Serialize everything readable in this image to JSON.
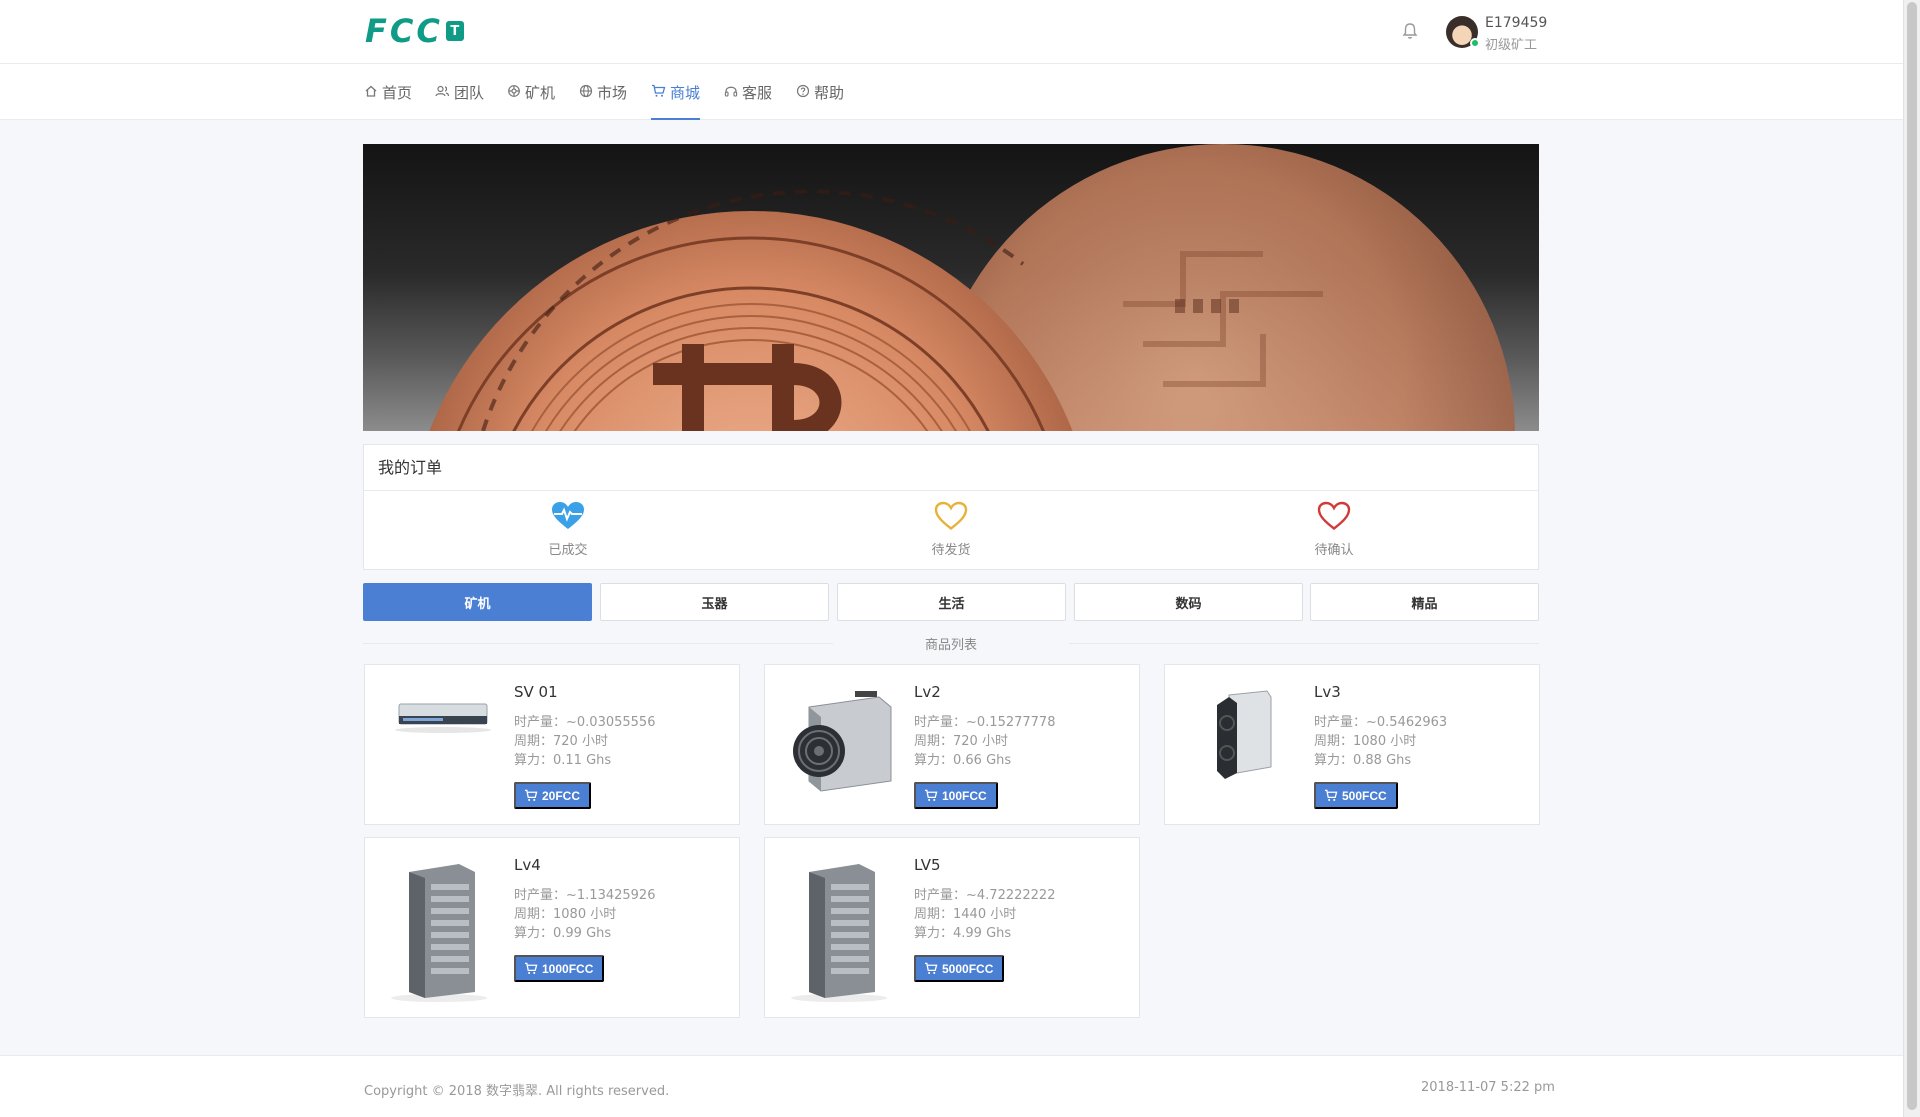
{
  "header": {
    "logo_text": "FCC",
    "logo_badge": "T",
    "user_id": "E179459",
    "user_level": "初级矿工"
  },
  "nav": {
    "items": [
      {
        "label": "首页",
        "icon": "home-icon"
      },
      {
        "label": "团队",
        "icon": "team-icon"
      },
      {
        "label": "矿机",
        "icon": "miner-icon"
      },
      {
        "label": "市场",
        "icon": "globe-icon"
      },
      {
        "label": "商城",
        "icon": "cart-icon",
        "active": true
      },
      {
        "label": "客服",
        "icon": "headset-icon"
      },
      {
        "label": "帮助",
        "icon": "help-icon"
      }
    ]
  },
  "orders": {
    "title": "我的订单",
    "statuses": [
      {
        "label": "已成交",
        "icon": "heartbeat-icon",
        "color": "#3aa0e8"
      },
      {
        "label": "待发货",
        "icon": "heart-outline-icon",
        "color": "#e6b23a"
      },
      {
        "label": "待确认",
        "icon": "heart-outline-icon",
        "color": "#d23a3a"
      }
    ]
  },
  "tabs": [
    {
      "label": "矿机",
      "active": true
    },
    {
      "label": "玉器"
    },
    {
      "label": "生活"
    },
    {
      "label": "数码"
    },
    {
      "label": "精品"
    }
  ],
  "list_title": "商品列表",
  "products": [
    {
      "name": "SV 01",
      "output": "时产量：~0.03055556",
      "period": "周期：720 小时",
      "power": "算力：0.11 Ghs",
      "price": "20FCC"
    },
    {
      "name": "Lv2",
      "output": "时产量：~0.15277778",
      "period": "周期：720 小时",
      "power": "算力：0.66 Ghs",
      "price": "100FCC"
    },
    {
      "name": "Lv3",
      "output": "时产量：~0.5462963",
      "period": "周期：1080 小时",
      "power": "算力：0.88 Ghs",
      "price": "500FCC"
    },
    {
      "name": "Lv4",
      "output": "时产量：~1.13425926",
      "period": "周期：1080 小时",
      "power": "算力：0.99 Ghs",
      "price": "1000FCC"
    },
    {
      "name": "LV5",
      "output": "时产量：~4.72222222",
      "period": "周期：1440 小时",
      "power": "算力：4.99 Ghs",
      "price": "5000FCC"
    }
  ],
  "footer": {
    "copyright": "Copyright © 2018 数字翡翠. All rights reserved.",
    "datetime": "2018-11-07 5:22 pm"
  },
  "colors": {
    "brand": "#0f9b85",
    "accent": "#4a7fd4"
  }
}
